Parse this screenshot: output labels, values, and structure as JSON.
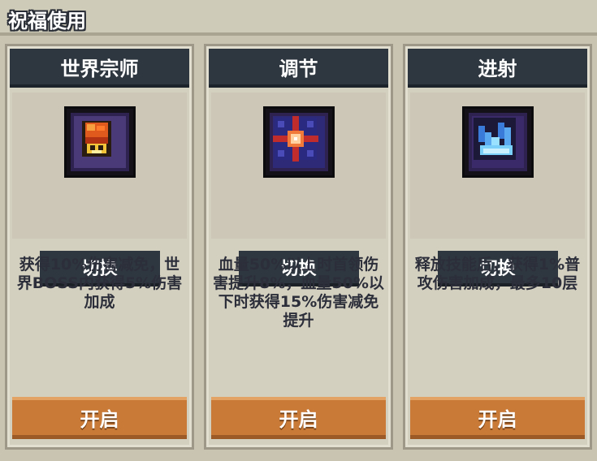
{
  "panel": {
    "title": "祝福使用"
  },
  "cards": [
    {
      "title": "世界宗师",
      "icon": "fire-chest-icon",
      "switch_label": "切换",
      "description": "获得10%伤害减免，世界BOSS内获得5%伤害加成",
      "open_label": "开启"
    },
    {
      "title": "调节",
      "icon": "cross-burst-icon",
      "switch_label": "切换",
      "description": "血量50%以上时首领伤害提升8%，血量50%以下时获得15%伤害减免提升",
      "open_label": "开启"
    },
    {
      "title": "进射",
      "icon": "ice-shards-icon",
      "switch_label": "切换",
      "description": "释放技能后，获得1%普攻伤害加成，最多10层",
      "open_label": "开启"
    }
  ]
}
